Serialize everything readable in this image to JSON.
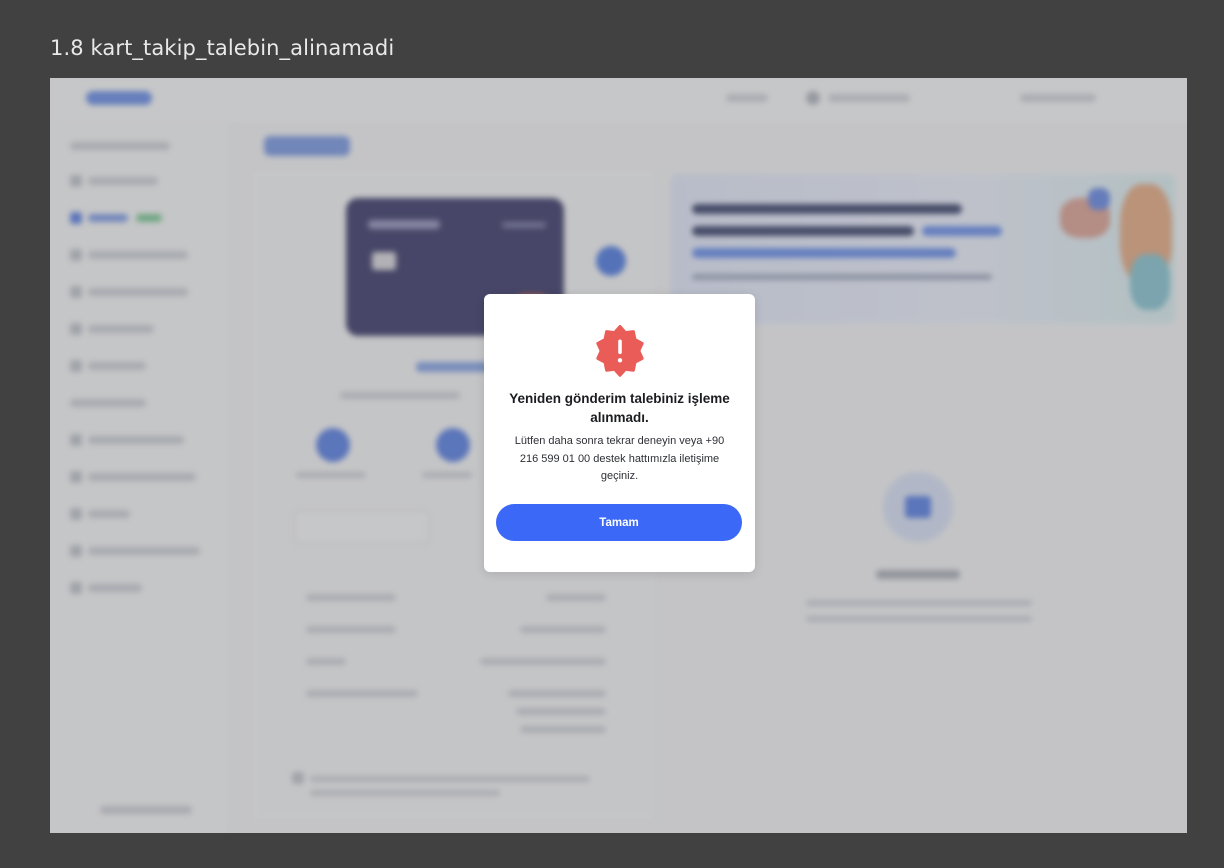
{
  "frame": {
    "title": "1.8 kart_takip_talebin_alinamadi"
  },
  "modal": {
    "icon": "alert-badge-icon",
    "title": "Yeniden gönderim talebiniz işleme alınmadı.",
    "message": "Lütfen daha sonra tekrar deneyin veya +90 216 599 01 00 destek hattımızla iletişime geçiniz.",
    "confirm_label": "Tamam"
  },
  "colors": {
    "background": "#414141",
    "accent": "#3b68f6",
    "alert": "#e95c58",
    "overlay": "rgba(120,120,120,0.38)"
  }
}
